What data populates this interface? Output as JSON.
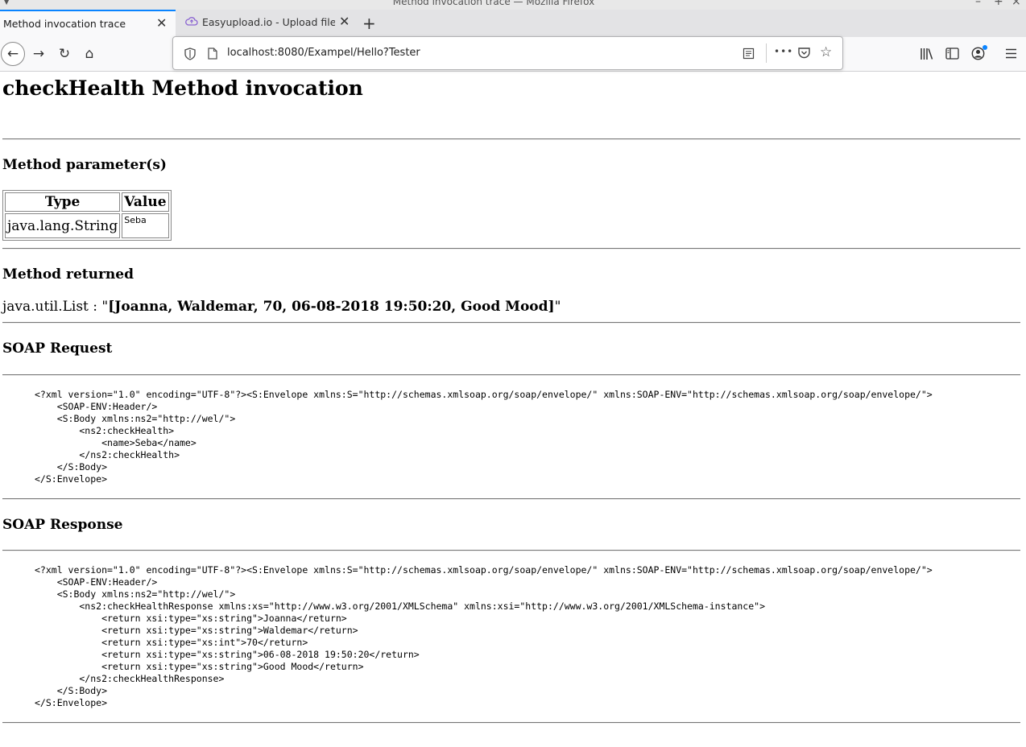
{
  "window": {
    "title": "Method invocation trace — Mozilla Firefox",
    "minimize": "–",
    "maximize": "+",
    "close": "×"
  },
  "tabs": [
    {
      "label": "Method invocation trace",
      "active": true
    },
    {
      "label": "Easyupload.io - Upload files fo",
      "active": false
    }
  ],
  "toolbar": {
    "new_tab": "+",
    "back": "←",
    "forward": "→",
    "reload": "↻",
    "home": "⌂",
    "url": "localhost:8080/Exampel/Hello?Tester",
    "more": "•••"
  },
  "page": {
    "title": "checkHealth Method invocation",
    "params_heading": "Method parameter(s)",
    "params_table": {
      "headers": [
        "Type",
        "Value"
      ],
      "rows": [
        [
          "java.lang.String",
          "Seba"
        ]
      ]
    },
    "returned_heading": "Method returned",
    "returned_type": "java.util.List : \"",
    "returned_value": "[Joanna, Waldemar, 70, 06-08-2018 19:50:20, Good Mood]",
    "returned_close": "\"",
    "request_heading": "SOAP Request",
    "request_xml": "<?xml version=\"1.0\" encoding=\"UTF-8\"?><S:Envelope xmlns:S=\"http://schemas.xmlsoap.org/soap/envelope/\" xmlns:SOAP-ENV=\"http://schemas.xmlsoap.org/soap/envelope/\">\n    <SOAP-ENV:Header/>\n    <S:Body xmlns:ns2=\"http://wel/\">\n        <ns2:checkHealth>\n            <name>Seba</name>\n        </ns2:checkHealth>\n    </S:Body>\n</S:Envelope>",
    "response_heading": "SOAP Response",
    "response_xml": "<?xml version=\"1.0\" encoding=\"UTF-8\"?><S:Envelope xmlns:S=\"http://schemas.xmlsoap.org/soap/envelope/\" xmlns:SOAP-ENV=\"http://schemas.xmlsoap.org/soap/envelope/\">\n    <SOAP-ENV:Header/>\n    <S:Body xmlns:ns2=\"http://wel/\">\n        <ns2:checkHealthResponse xmlns:xs=\"http://www.w3.org/2001/XMLSchema\" xmlns:xsi=\"http://www.w3.org/2001/XMLSchema-instance\">\n            <return xsi:type=\"xs:string\">Joanna</return>\n            <return xsi:type=\"xs:string\">Waldemar</return>\n            <return xsi:type=\"xs:int\">70</return>\n            <return xsi:type=\"xs:string\">06-08-2018 19:50:20</return>\n            <return xsi:type=\"xs:string\">Good Mood</return>\n        </ns2:checkHealthResponse>\n    </S:Body>\n</S:Envelope>"
  }
}
